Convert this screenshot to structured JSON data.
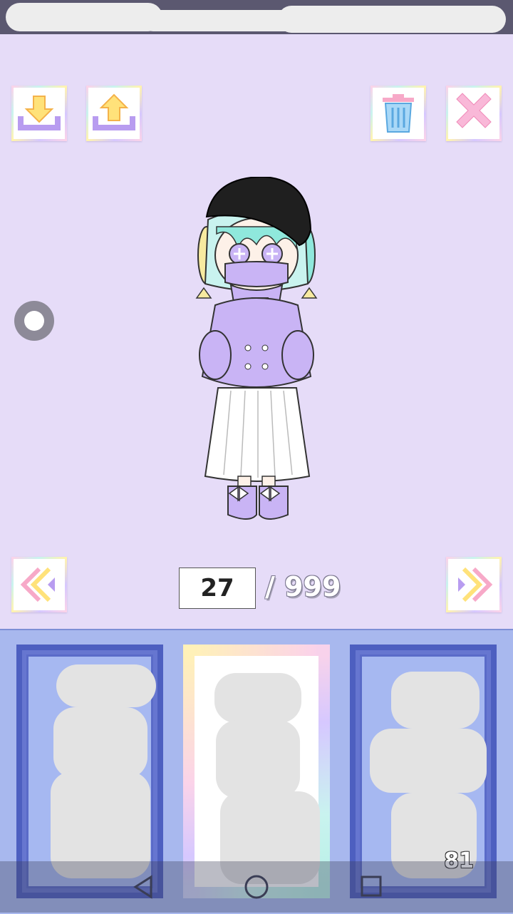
{
  "toolbar": {
    "download_icon": "download-tray-icon",
    "upload_icon": "upload-tray-icon",
    "delete_icon": "trash-icon",
    "close_icon": "close-x-icon"
  },
  "character": {
    "description_colors": {
      "coat": "#c9b4f5",
      "skirt": "#ffffff",
      "hat": "#1f1f1f",
      "hair_mint": "#8fe8dc",
      "hair_yellow": "#f7eaa0"
    }
  },
  "pager": {
    "prev_icon": "double-chevron-left-icon",
    "next_icon": "double-chevron-right-icon",
    "current": "27",
    "total": "/ 999"
  },
  "slots": {
    "left_label": "",
    "center_label": "",
    "right_label": "81"
  },
  "colors": {
    "background": "#e6dcf8",
    "tray": "#a8b8ee",
    "slot_blue": "#6676d0",
    "accent_purple": "#b89cf0",
    "accent_yellow": "#ffe27a"
  },
  "navigation": {
    "back_icon": "back-triangle-icon",
    "home_icon": "home-circle-icon",
    "recents_icon": "recents-square-icon"
  }
}
